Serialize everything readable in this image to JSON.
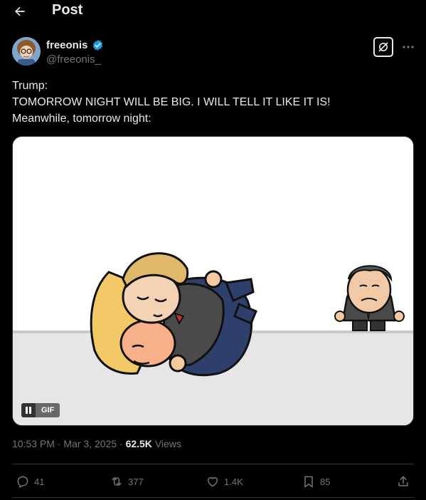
{
  "header": {
    "back_icon": "arrow-left-icon",
    "title": "Post"
  },
  "author": {
    "display_name": "freeonis",
    "handle": "@freeonis_",
    "verified": true,
    "verified_color": "#1d9bf0"
  },
  "tweet": {
    "lines": [
      "Trump:",
      "TOMORROW NIGHT WILL BE BIG. I WILL TELL IT LIKE IT IS!",
      "Meanwhile, tomorrow night:"
    ]
  },
  "media": {
    "badge": "GIF",
    "pause_icon": "pause-icon"
  },
  "meta": {
    "time": "10:53 PM",
    "separator": "·",
    "date": "Mar 3, 2025",
    "views_count": "62.5K",
    "views_label": "Views"
  },
  "actions": {
    "replies": "41",
    "reposts": "377",
    "likes": "1.4K",
    "bookmarks": "85"
  },
  "colors": {
    "background": "#000000",
    "text": "#e7e9ea",
    "muted": "#71767b",
    "border": "#2f3336"
  }
}
